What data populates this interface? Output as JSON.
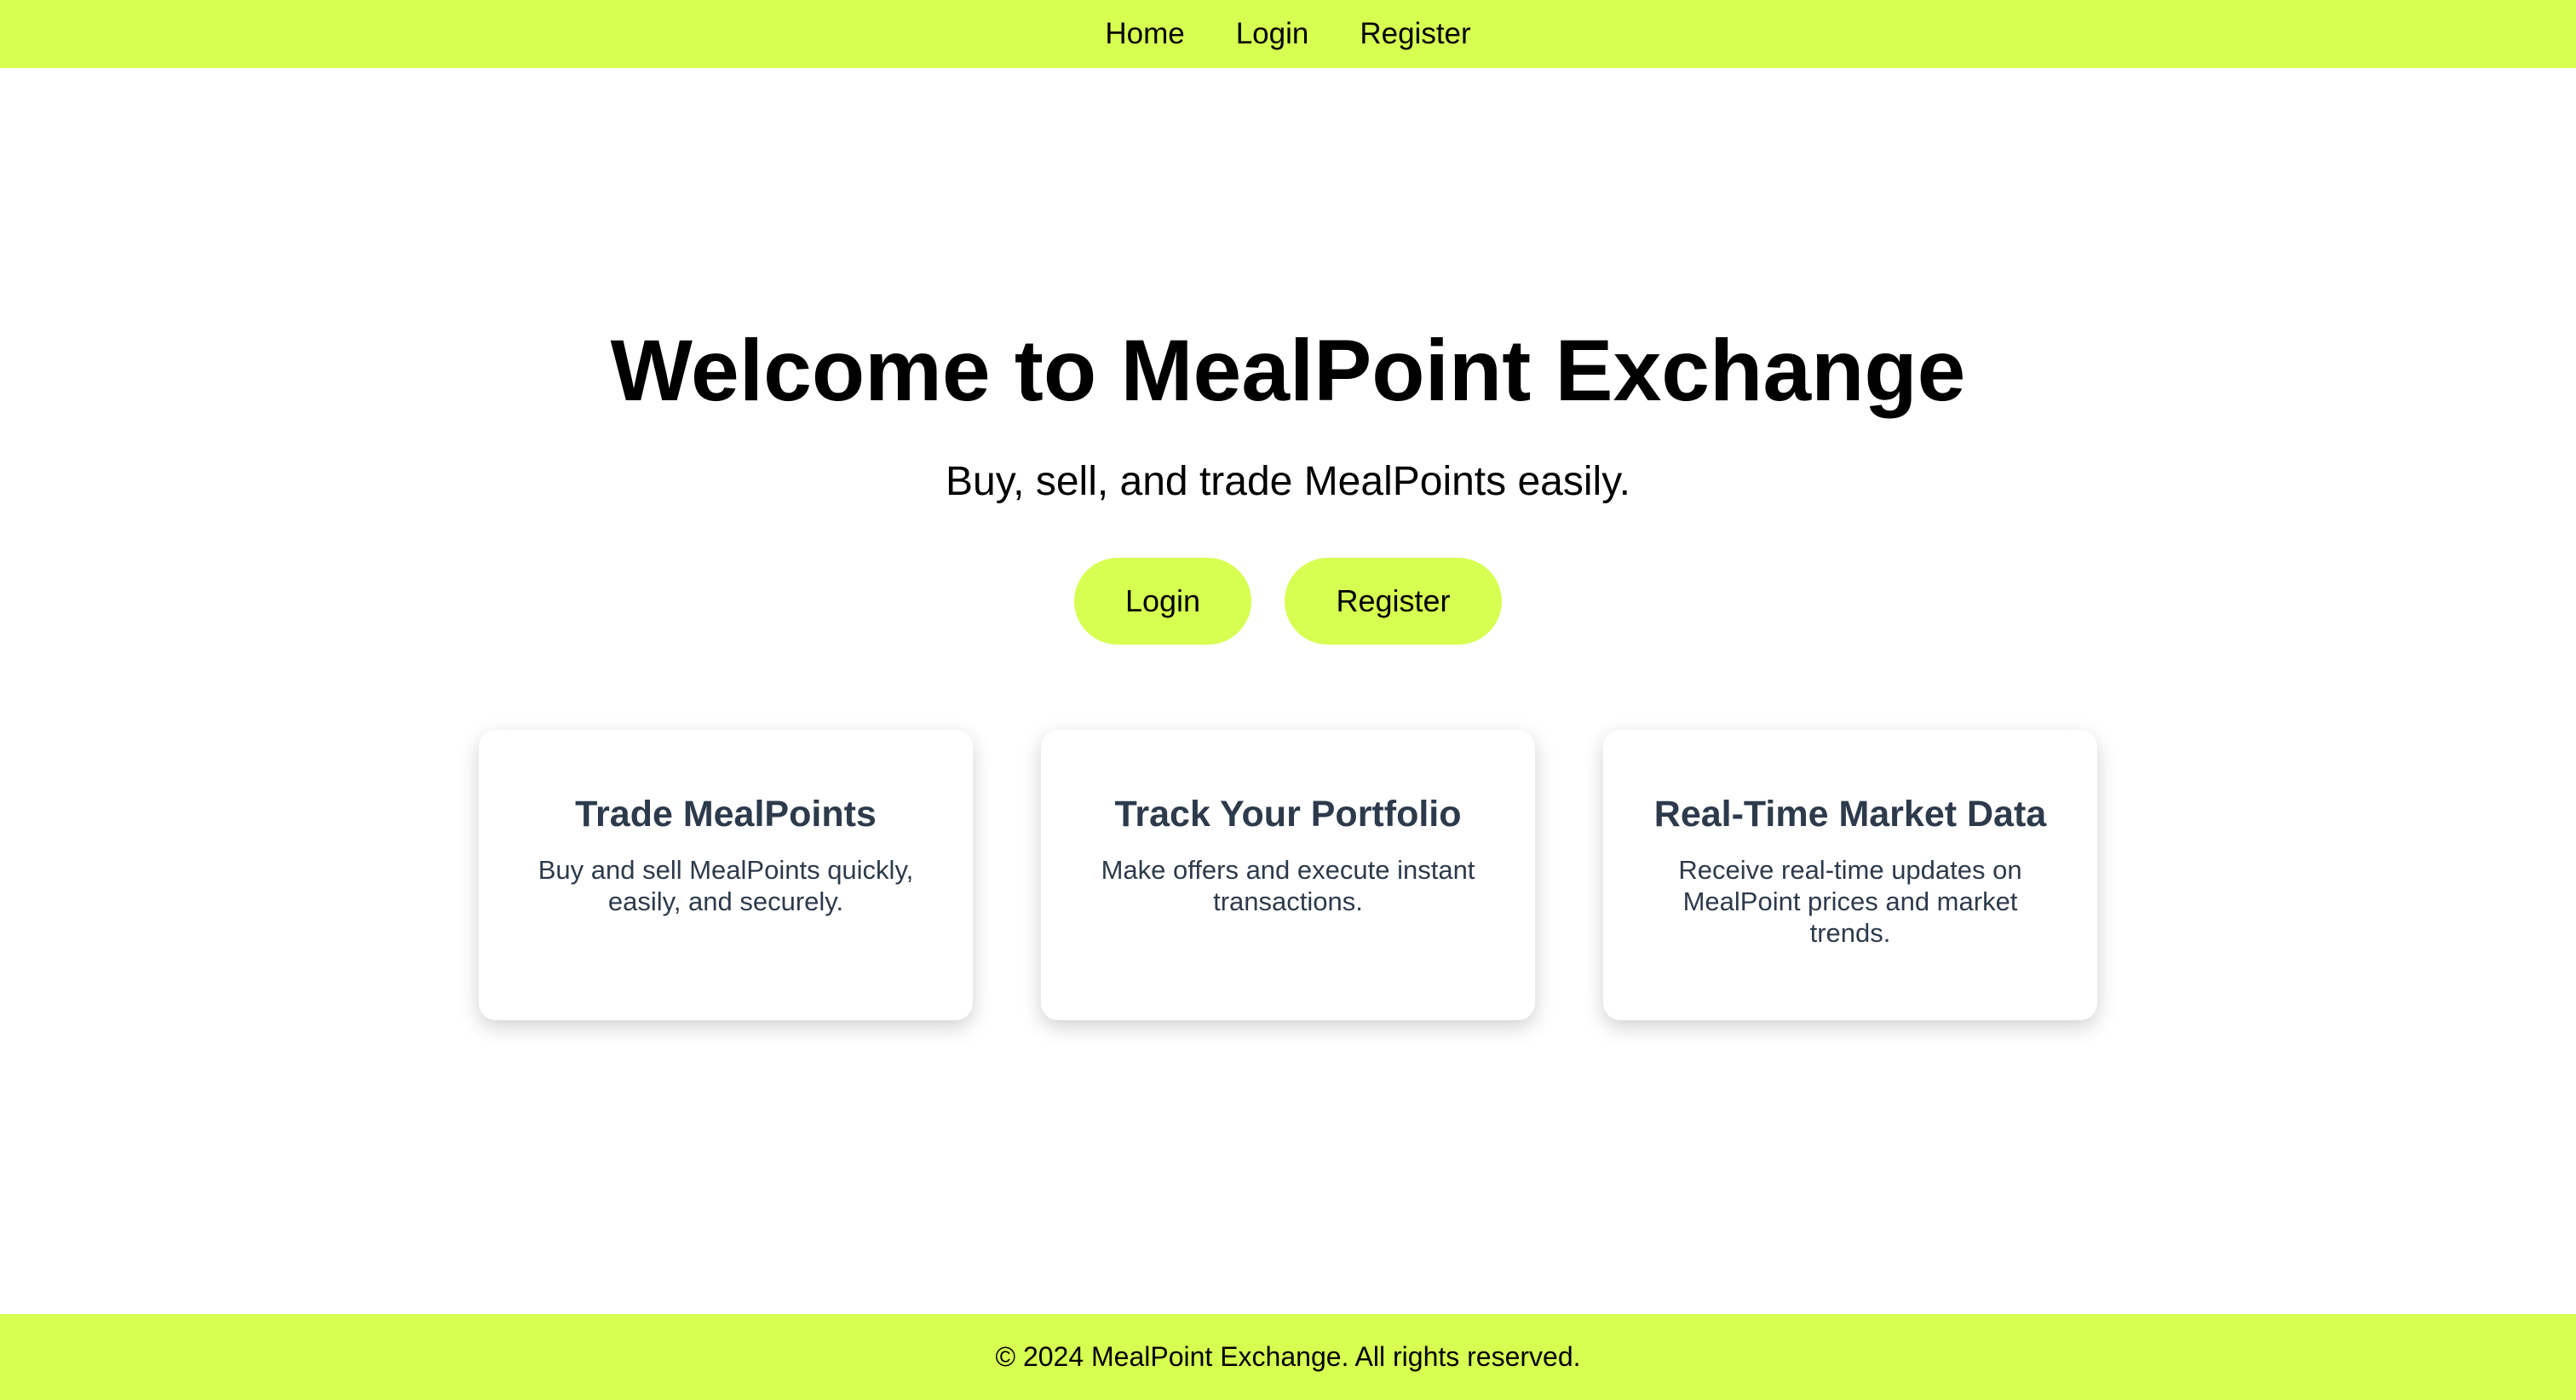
{
  "nav": {
    "items": [
      {
        "label": "Home"
      },
      {
        "label": "Login"
      },
      {
        "label": "Register"
      }
    ]
  },
  "hero": {
    "title": "Welcome to MealPoint Exchange",
    "subtitle": "Buy, sell, and trade MealPoints easily.",
    "login_label": "Login",
    "register_label": "Register"
  },
  "features": [
    {
      "title": "Trade MealPoints",
      "description": "Buy and sell MealPoints quickly, easily, and securely."
    },
    {
      "title": "Track Your Portfolio",
      "description": "Make offers and execute instant transactions."
    },
    {
      "title": "Real-Time Market Data",
      "description": "Receive real-time updates on MealPoint prices and market trends."
    }
  ],
  "footer": {
    "text": "© 2024 MealPoint Exchange. All rights reserved."
  },
  "colors": {
    "accent": "#d7ff52",
    "card_text": "#2d3a4b"
  }
}
